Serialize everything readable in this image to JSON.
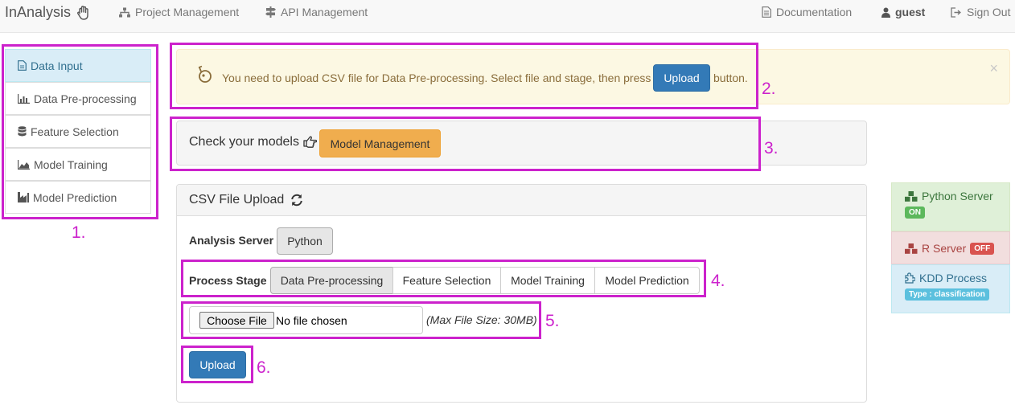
{
  "navbar": {
    "brand": "InAnalysis",
    "project_management": "Project Management",
    "api_management": "API Management",
    "documentation": "Documentation",
    "user": "guest",
    "sign_out": "Sign Out"
  },
  "sidebar": {
    "items": [
      {
        "label": "Data Input",
        "icon": "file-icon",
        "active": true
      },
      {
        "label": "Data Pre-processing",
        "icon": "bar-chart-icon"
      },
      {
        "label": "Feature Selection",
        "icon": "database-icon"
      },
      {
        "label": "Model Training",
        "icon": "area-chart-icon"
      },
      {
        "label": "Model Prediction",
        "icon": "industry-icon"
      }
    ]
  },
  "alert": {
    "text": "You need to upload CSV file for Data Pre-processing. Select file and stage, then press",
    "button": "Upload",
    "suffix": "button.",
    "close": "×",
    "icon": "lightbulb-icon"
  },
  "models_panel": {
    "text": "Check your models",
    "icon": "hand-point-right-icon",
    "button": "Model Management"
  },
  "upload_panel": {
    "title": "CSV File Upload",
    "refresh_icon": "refresh-icon",
    "analysis_server_label": "Analysis Server",
    "analysis_server_value": "Python",
    "process_stage_label": "Process Stage",
    "stages": [
      "Data Pre-processing",
      "Feature Selection",
      "Model Training",
      "Model Prediction"
    ],
    "selected_stage": "Data Pre-processing",
    "choose_file": "Choose File",
    "no_file": "No file chosen",
    "max_size": "(Max File Size: 30MB)",
    "upload_button": "Upload"
  },
  "servers": {
    "python": {
      "label": "Python Server",
      "status": "ON",
      "color": "#5cb85c",
      "bg": "#dff0d8"
    },
    "r": {
      "label": "R Server",
      "status": "OFF",
      "color": "#d9534f",
      "bg": "#f2dede"
    },
    "kdd": {
      "label": "KDD Process",
      "type": "Type : classification",
      "color": "#5bc0de",
      "bg": "#d9edf7"
    }
  },
  "annotations": [
    "1.",
    "2.",
    "3.",
    "4.",
    "5.",
    "6."
  ],
  "colors": {
    "annotation": "#cc22cc",
    "primary": "#337ab7",
    "warning": "#f0ad4e"
  }
}
